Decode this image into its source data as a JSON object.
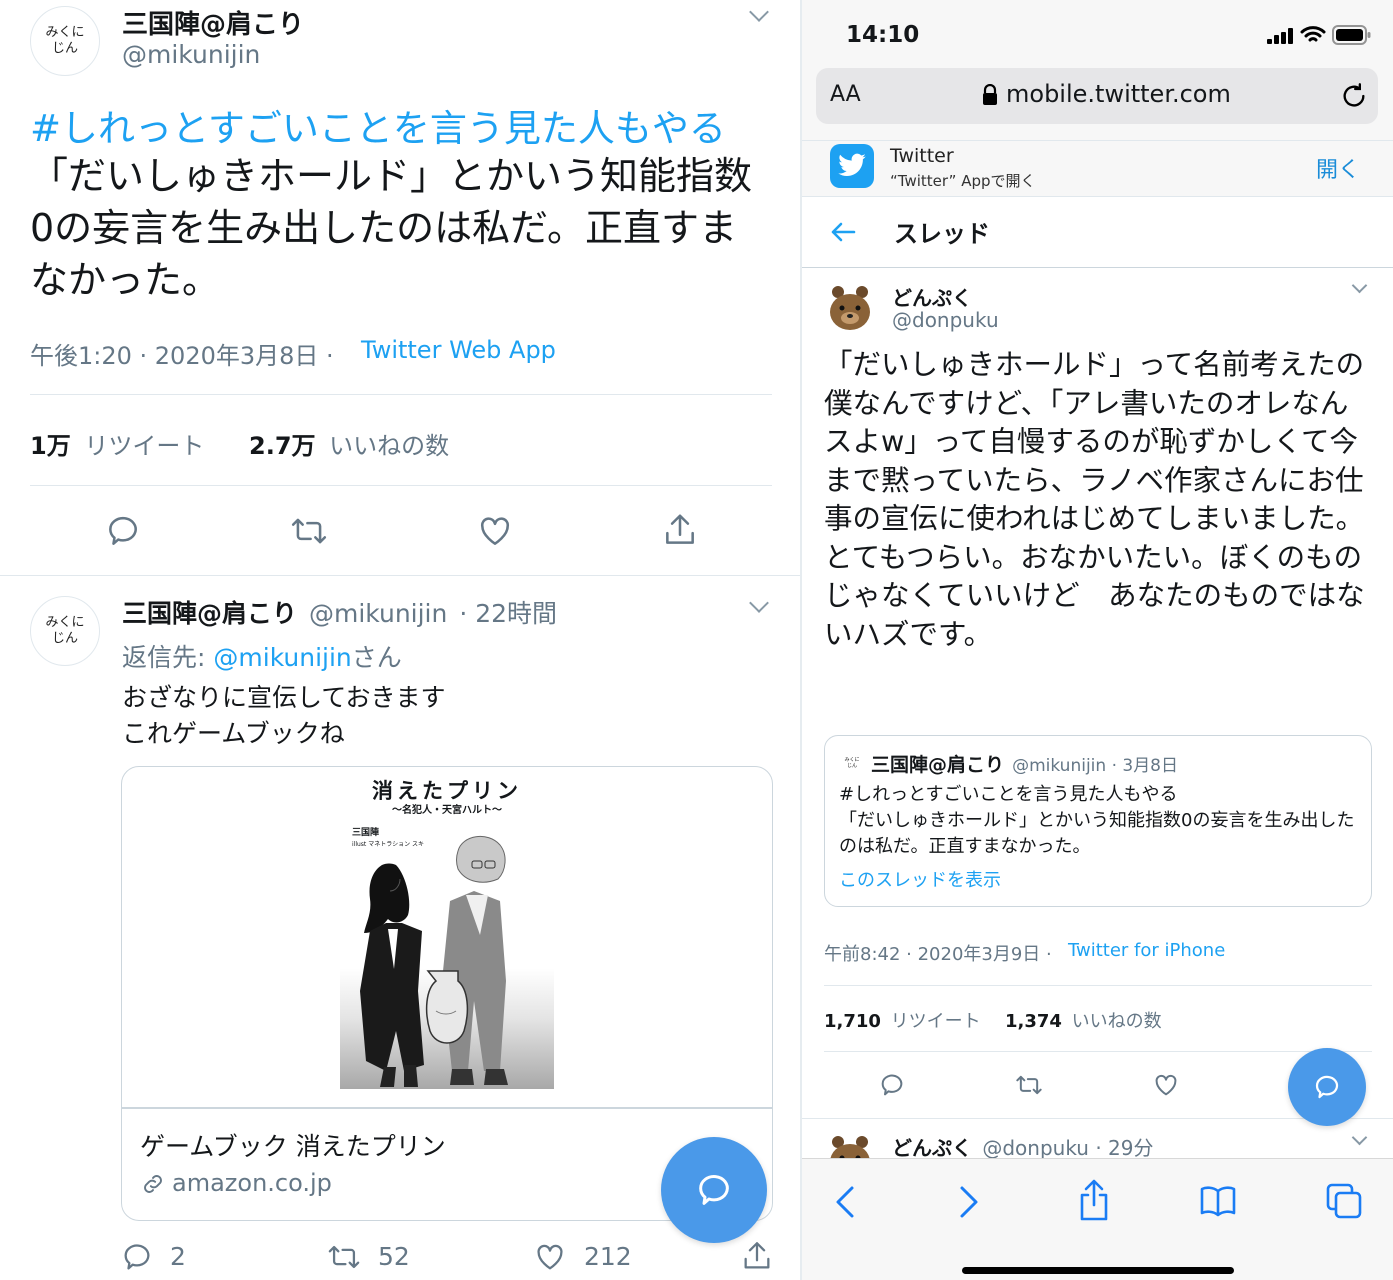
{
  "left": {
    "main_tweet": {
      "avatar_text": "みくに\nじん",
      "display_name": "三国陣@肩こり",
      "handle": "@mikunijin",
      "hashtag": "#しれっとすごいことを言う見た人もやる",
      "text": "「だいしゅきホールド」とかいう知能指数0の妄言を生み出したのは私だ。正直すまなかった。",
      "time": "午後1:20 · 2020年3月8日 ·",
      "source": "Twitter Web App",
      "retweet_count": "1万",
      "retweet_label": "リツイート",
      "like_count": "2.7万",
      "like_label": "いいねの数"
    },
    "reply": {
      "avatar_text": "みくに\nじん",
      "display_name": "三国陣@肩こり",
      "handle": "@mikunijin",
      "time": "· 22時間",
      "reply_prefix": "返信先:",
      "reply_to": "@mikunijin",
      "reply_suffix": "さん",
      "text_line1": "おざなりに宣伝しておきます",
      "text_line2": "これゲームブックね",
      "card": {
        "cover_title": "消えたプリン",
        "cover_subtitle": "～名犯人・天宮ハルト～",
        "cover_author": "三国陣",
        "cover_illust": "illust マネトラション スキ",
        "title": "ゲームブック 消えたプリン",
        "domain": "amazon.co.jp"
      },
      "reply_count": "2",
      "retweet_count": "52",
      "like_count": "212"
    }
  },
  "right": {
    "status_bar": {
      "time": "14:10"
    },
    "browser": {
      "aa_label": "AA",
      "url": "mobile.twitter.com"
    },
    "app_banner": {
      "name": "Twitter",
      "subtitle": "“Twitter” Appで開く",
      "open_label": "開く"
    },
    "header": {
      "title": "スレッド"
    },
    "tweet": {
      "display_name": "どんぷく",
      "handle": "@donpuku",
      "text": "「だいしゅきホールド」って名前考えたの僕なんですけど、「アレ書いたのオレなんスよw」って自慢するのが恥ずかしくて今まで黙っていたら、ラノベ作家さんにお仕事の宣伝に使われはじめてしまいました。\nとてもつらい。おなかいたい。ぼくのものじゃなくていいけど　あなたのものではないハズです。",
      "quote": {
        "avatar_text": "みくに\nじん",
        "display_name": "三国陣@肩こり",
        "handle_time": "@mikunijin · 3月8日",
        "text": "#しれっとすごいことを言う見た人もやる\n「だいしゅきホールド」とかいう知能指数0の妄言を生み出したのは私だ。正直すまなかった。",
        "link": "このスレッドを表示"
      },
      "time": "午前8:42 · 2020年3月9日 ·",
      "source": "Twitter for iPhone",
      "retweet_count": "1,710",
      "retweet_label": "リツイート",
      "like_count": "1,374",
      "like_label": "いいねの数"
    },
    "next_tweet": {
      "display_name": "どんぷく",
      "handle_time": "@donpuku · 29分"
    }
  },
  "colors": {
    "accent": "#1da1f2",
    "fab": "#4a99e9",
    "gray": "#657786"
  },
  "icons": [
    "reply-icon",
    "retweet-icon",
    "like-icon",
    "share-icon",
    "compose-icon",
    "lock-icon",
    "reload-icon",
    "back-arrow-icon",
    "link-icon",
    "chevron-down-icon",
    "twitter-bird-icon",
    "safari-back-icon",
    "safari-forward-icon",
    "safari-share-icon",
    "bookmarks-icon",
    "tabs-icon",
    "signal-icon",
    "wifi-icon",
    "battery-icon"
  ]
}
